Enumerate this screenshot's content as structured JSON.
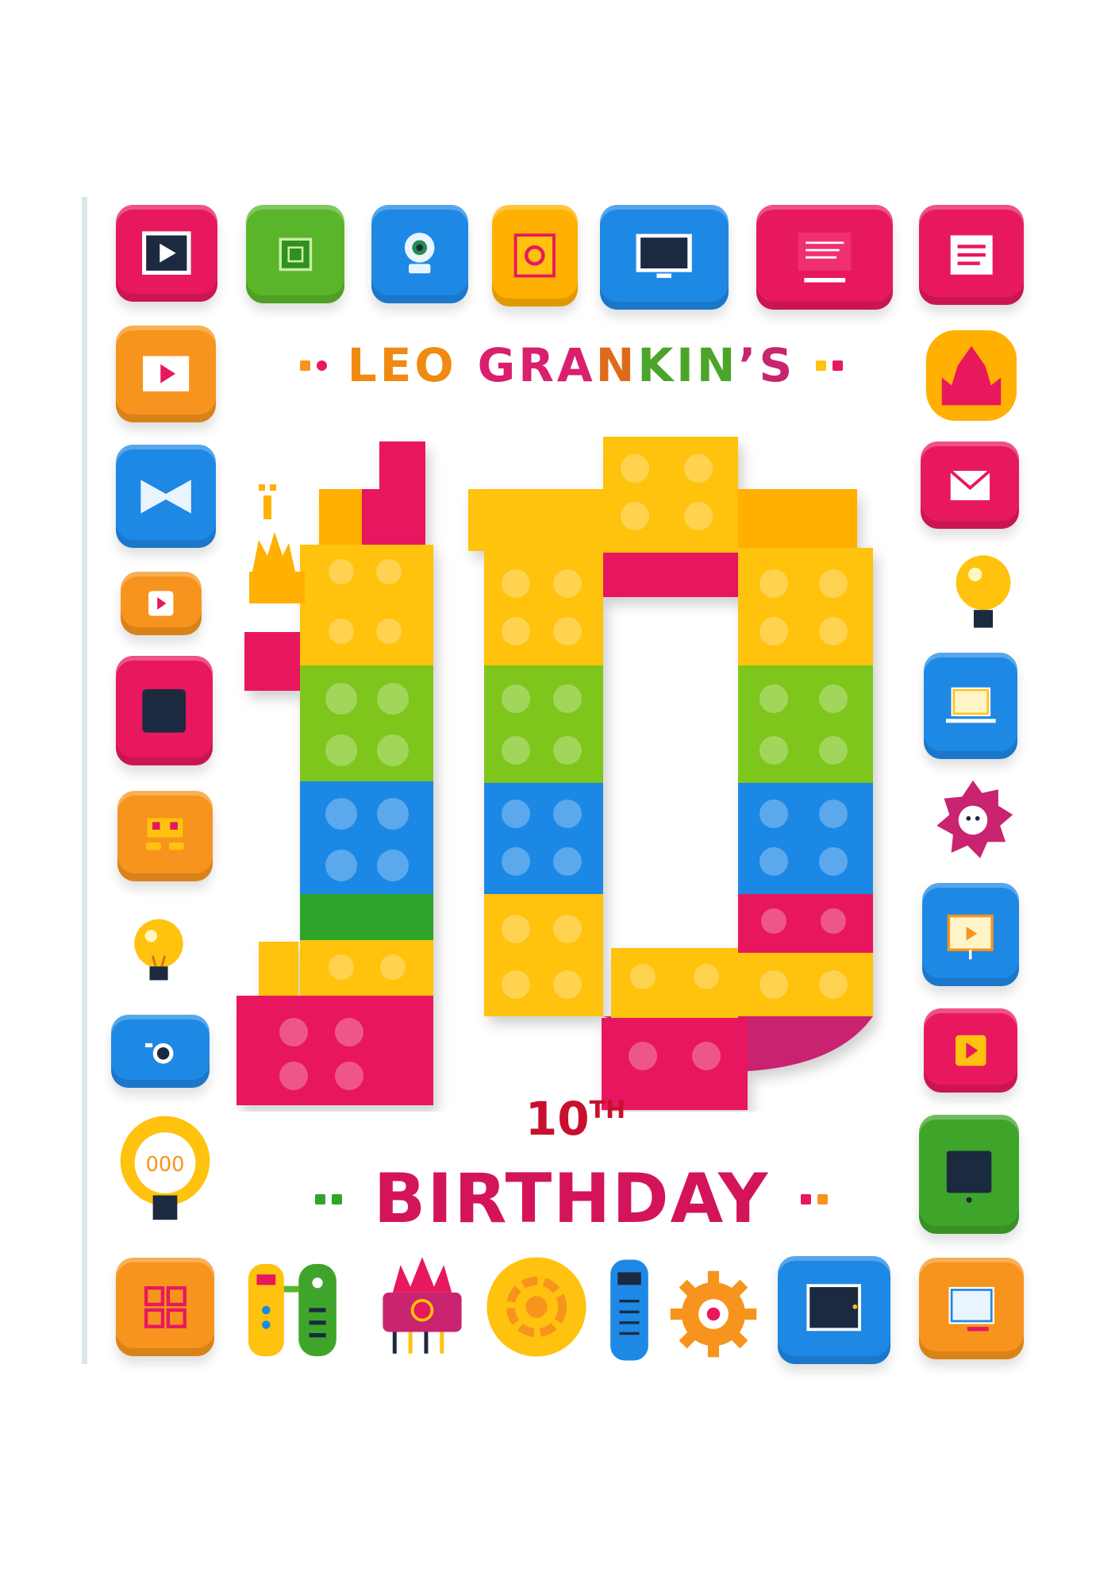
{
  "title": {
    "name_first": "LEO",
    "name_last_parts": [
      "GRA",
      "N",
      "KIN",
      "’S"
    ],
    "ordinal_number": "10",
    "ordinal_suffix": "TH",
    "event": "BIRTHDAY"
  },
  "colors": {
    "pink": "#e8185f",
    "green": "#5ab52a",
    "blue": "#1e88e5",
    "orange": "#f7941d",
    "yellow": "#ffc20e",
    "red": "#d4145a"
  },
  "icons": {
    "top_row": [
      "play-screen-icon",
      "chip-icon",
      "webcam-icon",
      "target-box-icon",
      "monitor-icon",
      "document-screen-icon",
      "note-icon"
    ],
    "left_column": [
      "video-play-icon",
      "bowtie-icon",
      "play-button-icon",
      "tablet-icon",
      "robot-face-icon",
      "lightbulb-icon",
      "camera-icon",
      "lightbulb-large-icon"
    ],
    "right_column": [
      "castle-icon",
      "mail-icon",
      "lightbulb-icon",
      "laptop-icon",
      "gear-creature-icon",
      "presentation-icon",
      "play-button-icon",
      "tablet-icon"
    ],
    "bottom_row": [
      "circuit-board-icon",
      "remote-controls-icon",
      "crown-robot-icon",
      "gear-coin-icon",
      "phone-remote-icon",
      "gear-icon",
      "monitor-icon",
      "screen-icon"
    ]
  }
}
